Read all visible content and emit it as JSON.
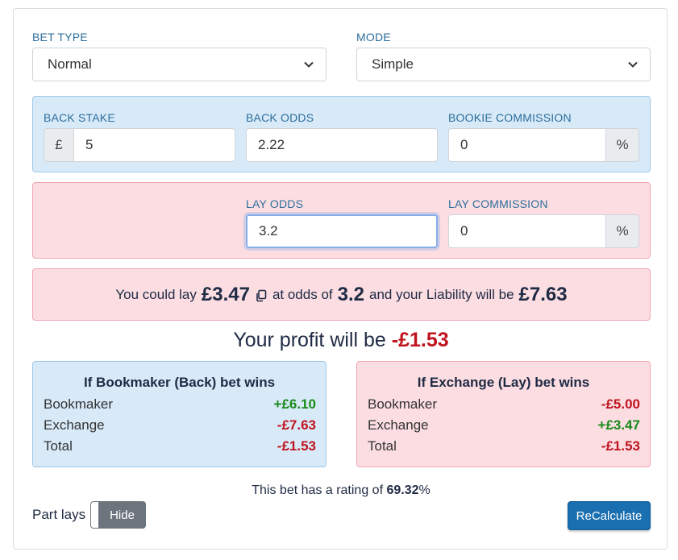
{
  "bet_type": {
    "label": "BET TYPE",
    "value": "Normal"
  },
  "mode": {
    "label": "MODE",
    "value": "Simple"
  },
  "back": {
    "stake_label": "BACK STAKE",
    "currency": "£",
    "stake_value": "5",
    "odds_label": "BACK ODDS",
    "odds_value": "2.22",
    "commission_label": "BOOKIE COMMISSION",
    "commission_value": "0",
    "percent": "%"
  },
  "lay": {
    "odds_label": "LAY ODDS",
    "odds_value": "3.2",
    "commission_label": "LAY COMMISSION",
    "commission_value": "0",
    "percent": "%"
  },
  "summary": {
    "p1": "You could lay",
    "lay_stake": "£3.47",
    "p2": "at odds of",
    "odds": "3.2",
    "p3": "and your Liability will be",
    "liability": "£7.63"
  },
  "profit": {
    "text": "Your profit will be",
    "value": "-£1.53"
  },
  "bookmaker_wins": {
    "title": "If Bookmaker (Back) bet wins",
    "rows": [
      {
        "label": "Bookmaker",
        "value": "+£6.10"
      },
      {
        "label": "Exchange",
        "value": "-£7.63"
      },
      {
        "label": "Total",
        "value": "-£1.53"
      }
    ]
  },
  "exchange_wins": {
    "title": "If Exchange (Lay) bet wins",
    "rows": [
      {
        "label": "Bookmaker",
        "value": "-£5.00"
      },
      {
        "label": "Exchange",
        "value": "+£3.47"
      },
      {
        "label": "Total",
        "value": "-£1.53"
      }
    ]
  },
  "rating": {
    "text": "This bet has a rating of",
    "value": "69.32",
    "suffix": "%"
  },
  "part_lays": {
    "label": "Part lays",
    "toggle": "Hide"
  },
  "recalc_label": "ReCalculate",
  "colors": {
    "positive": "#1a8a1a",
    "negative": "#c0141e",
    "accent": "#1a6fb0"
  }
}
